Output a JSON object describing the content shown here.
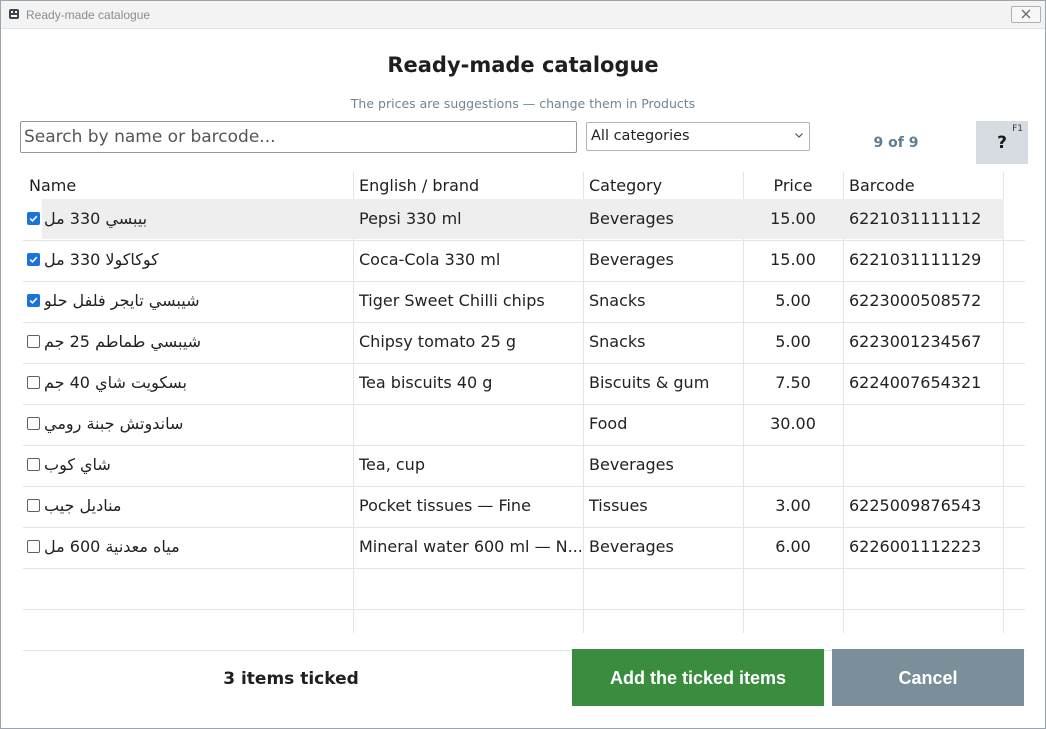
{
  "window": {
    "title": "Ready-made catalogue"
  },
  "heading": "Ready-made catalogue",
  "subheading": "The prices are suggestions — change them in Products",
  "search": {
    "placeholder": "Search by name or barcode..."
  },
  "category_select": {
    "value": "All categories"
  },
  "count": "9 of 9",
  "help": {
    "label": "?",
    "shortcut": "F1"
  },
  "columns": {
    "name": "Name",
    "english": "English / brand",
    "category": "Category",
    "price": "Price",
    "barcode": "Barcode"
  },
  "rows": [
    {
      "checked": true,
      "name": "بيبسي 330 مل",
      "english": "Pepsi 330 ml",
      "category": "Beverages",
      "price": "15.00",
      "barcode": "6221031111112"
    },
    {
      "checked": true,
      "name": "كوكاكولا 330 مل",
      "english": "Coca-Cola 330 ml",
      "category": "Beverages",
      "price": "15.00",
      "barcode": "6221031111129"
    },
    {
      "checked": true,
      "name": "شيبسي تايجر فلفل حلو",
      "english": "Tiger Sweet Chilli chips",
      "category": "Snacks",
      "price": "5.00",
      "barcode": "6223000508572"
    },
    {
      "checked": false,
      "name": "شيبسي طماطم 25 جم",
      "english": "Chipsy tomato 25 g",
      "category": "Snacks",
      "price": "5.00",
      "barcode": "6223001234567"
    },
    {
      "checked": false,
      "name": "بسكويت شاي 40 جم",
      "english": "Tea biscuits 40 g",
      "category": "Biscuits & gum",
      "price": "7.50",
      "barcode": "6224007654321"
    },
    {
      "checked": false,
      "name": "ساندوتش جبنة رومي",
      "english": "",
      "category": "Food",
      "price": "30.00",
      "barcode": ""
    },
    {
      "checked": false,
      "name": "شاي كوب",
      "english": "Tea, cup",
      "category": "Beverages",
      "price": "",
      "barcode": ""
    },
    {
      "checked": false,
      "name": "مناديل جيب",
      "english": "Pocket tissues — Fine",
      "category": "Tissues",
      "price": "3.00",
      "barcode": "6225009876543"
    },
    {
      "checked": false,
      "name": "مياه معدنية 600 مل",
      "english": "Mineral water 600 ml — N...",
      "category": "Beverages",
      "price": "6.00",
      "barcode": "6226001112223"
    }
  ],
  "footer": {
    "ticked": "3 items ticked",
    "add_label": "Add the ticked items",
    "cancel_label": "Cancel"
  },
  "colors": {
    "add": "#3a8c3f",
    "cancel": "#7b8f9b",
    "checkbox": "#1a73d9",
    "count": "#5b7d96"
  }
}
